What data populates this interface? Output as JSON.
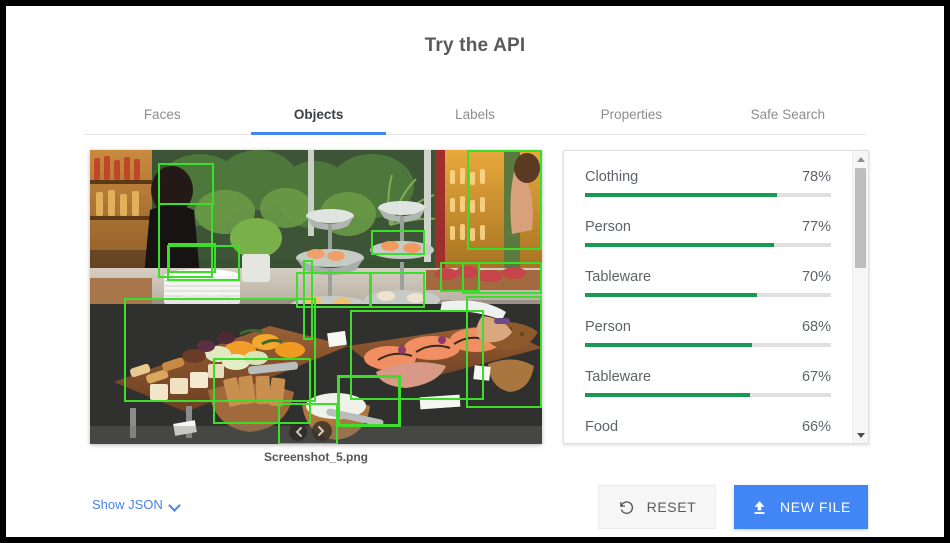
{
  "header": {
    "title": "Try the API"
  },
  "tabs": [
    {
      "label": "Faces",
      "active": false
    },
    {
      "label": "Objects",
      "active": true
    },
    {
      "label": "Labels",
      "active": false
    },
    {
      "label": "Properties",
      "active": false
    },
    {
      "label": "Safe Search",
      "active": false
    }
  ],
  "image": {
    "filename": "Screenshot_5.png",
    "alt": "Buffet table with charcuterie boards, cheese, crackers, smoked salmon and tiered seafood stands",
    "detection_box_color": "#3ddd2c"
  },
  "results": {
    "accent_color": "#189a55",
    "track_color": "#e0e0e0",
    "items": [
      {
        "label": "Clothing",
        "score": "78%",
        "value": 78
      },
      {
        "label": "Person",
        "score": "77%",
        "value": 77
      },
      {
        "label": "Tableware",
        "score": "70%",
        "value": 70
      },
      {
        "label": "Person",
        "score": "68%",
        "value": 68
      },
      {
        "label": "Tableware",
        "score": "67%",
        "value": 67
      },
      {
        "label": "Food",
        "score": "66%",
        "value": 66
      }
    ]
  },
  "footer": {
    "show_json_label": "Show JSON",
    "reset_label": "RESET",
    "new_file_label": "NEW FILE",
    "link_color": "#4a83ea",
    "primary_button_color": "#4285f4"
  }
}
